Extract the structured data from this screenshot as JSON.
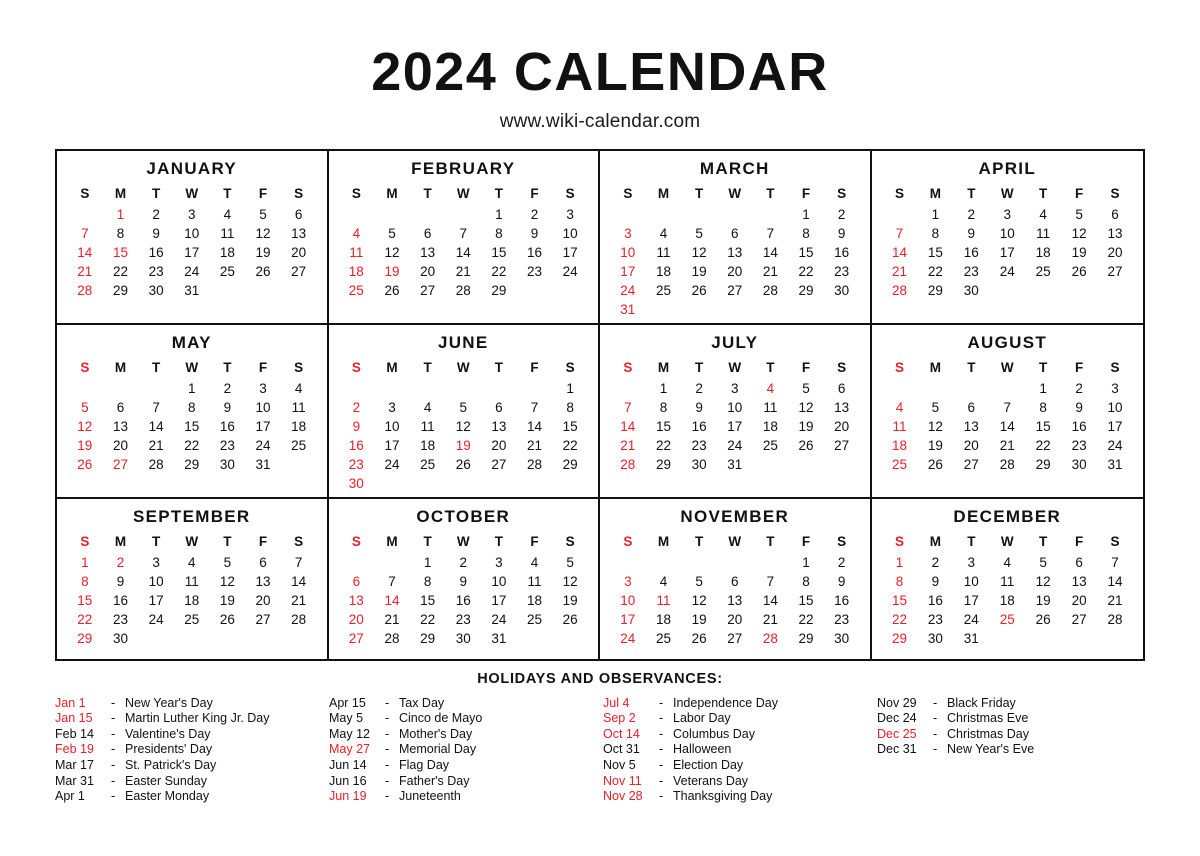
{
  "header": {
    "title": "2024 CALENDAR",
    "subtitle": "www.wiki-calendar.com"
  },
  "colors": {
    "accent_red": "#e8202a",
    "text_black": "#111111",
    "background": "#ffffff"
  },
  "weekday_headers": [
    "S",
    "M",
    "T",
    "W",
    "T",
    "F",
    "S"
  ],
  "months": [
    {
      "name": "JANUARY",
      "sunday_header_red": false,
      "lead_blanks": 1,
      "days": 31,
      "red_days": [
        1,
        7,
        14,
        15,
        21,
        28
      ]
    },
    {
      "name": "FEBRUARY",
      "sunday_header_red": false,
      "lead_blanks": 4,
      "days": 29,
      "red_days": [
        4,
        11,
        18,
        19,
        25
      ]
    },
    {
      "name": "MARCH",
      "sunday_header_red": false,
      "lead_blanks": 5,
      "days": 31,
      "red_days": [
        3,
        10,
        17,
        24,
        31
      ]
    },
    {
      "name": "APRIL",
      "sunday_header_red": false,
      "lead_blanks": 1,
      "days": 30,
      "red_days": [
        7,
        14,
        21,
        28
      ]
    },
    {
      "name": "MAY",
      "sunday_header_red": true,
      "lead_blanks": 3,
      "days": 31,
      "red_days": [
        5,
        12,
        19,
        26,
        27
      ]
    },
    {
      "name": "JUNE",
      "sunday_header_red": true,
      "lead_blanks": 6,
      "days": 30,
      "red_days": [
        2,
        9,
        16,
        19,
        23,
        30
      ]
    },
    {
      "name": "JULY",
      "sunday_header_red": true,
      "lead_blanks": 1,
      "days": 31,
      "red_days": [
        4,
        7,
        14,
        21,
        28
      ]
    },
    {
      "name": "AUGUST",
      "sunday_header_red": true,
      "lead_blanks": 4,
      "days": 31,
      "red_days": [
        4,
        11,
        18,
        25
      ]
    },
    {
      "name": "SEPTEMBER",
      "sunday_header_red": true,
      "lead_blanks": 0,
      "days": 30,
      "red_days": [
        1,
        2,
        8,
        15,
        22,
        29
      ]
    },
    {
      "name": "OCTOBER",
      "sunday_header_red": true,
      "lead_blanks": 2,
      "days": 31,
      "red_days": [
        6,
        13,
        14,
        20,
        27
      ]
    },
    {
      "name": "NOVEMBER",
      "sunday_header_red": true,
      "lead_blanks": 5,
      "days": 30,
      "red_days": [
        3,
        10,
        11,
        17,
        24,
        28
      ]
    },
    {
      "name": "DECEMBER",
      "sunday_header_red": true,
      "lead_blanks": 0,
      "days": 31,
      "red_days": [
        1,
        8,
        15,
        22,
        25,
        29
      ]
    }
  ],
  "holidays": {
    "title": "HOLIDAYS AND OBSERVANCES:",
    "dash": "-",
    "columns": [
      [
        {
          "date": "Jan 1",
          "name": "New Year's Day",
          "red": true
        },
        {
          "date": "Jan 15",
          "name": "Martin Luther King Jr. Day",
          "red": true
        },
        {
          "date": "Feb 14",
          "name": "Valentine's Day",
          "red": false
        },
        {
          "date": "Feb 19",
          "name": "Presidents' Day",
          "red": true
        },
        {
          "date": "Mar 17",
          "name": "St. Patrick's Day",
          "red": false
        },
        {
          "date": "Mar 31",
          "name": "Easter Sunday",
          "red": false
        },
        {
          "date": "Apr 1",
          "name": "Easter Monday",
          "red": false
        }
      ],
      [
        {
          "date": "Apr 15",
          "name": "Tax Day",
          "red": false
        },
        {
          "date": "May 5",
          "name": "Cinco de Mayo",
          "red": false
        },
        {
          "date": "May 12",
          "name": "Mother's Day",
          "red": false
        },
        {
          "date": "May 27",
          "name": "Memorial Day",
          "red": true
        },
        {
          "date": "Jun 14",
          "name": "Flag Day",
          "red": false
        },
        {
          "date": "Jun 16",
          "name": "Father's Day",
          "red": false
        },
        {
          "date": "Jun 19",
          "name": "Juneteenth",
          "red": true
        }
      ],
      [
        {
          "date": "Jul 4",
          "name": "Independence Day",
          "red": true
        },
        {
          "date": "Sep 2",
          "name": "Labor Day",
          "red": true
        },
        {
          "date": "Oct 14",
          "name": "Columbus Day",
          "red": true
        },
        {
          "date": "Oct 31",
          "name": "Halloween",
          "red": false
        },
        {
          "date": "Nov 5",
          "name": "Election Day",
          "red": false
        },
        {
          "date": "Nov 11",
          "name": "Veterans Day",
          "red": true
        },
        {
          "date": "Nov 28",
          "name": "Thanksgiving Day",
          "red": true
        }
      ],
      [
        {
          "date": "Nov 29",
          "name": "Black Friday",
          "red": false
        },
        {
          "date": "Dec 24",
          "name": "Christmas Eve",
          "red": false
        },
        {
          "date": "Dec 25",
          "name": "Christmas Day",
          "red": true
        },
        {
          "date": "Dec 31",
          "name": "New Year's Eve",
          "red": false
        }
      ]
    ]
  }
}
